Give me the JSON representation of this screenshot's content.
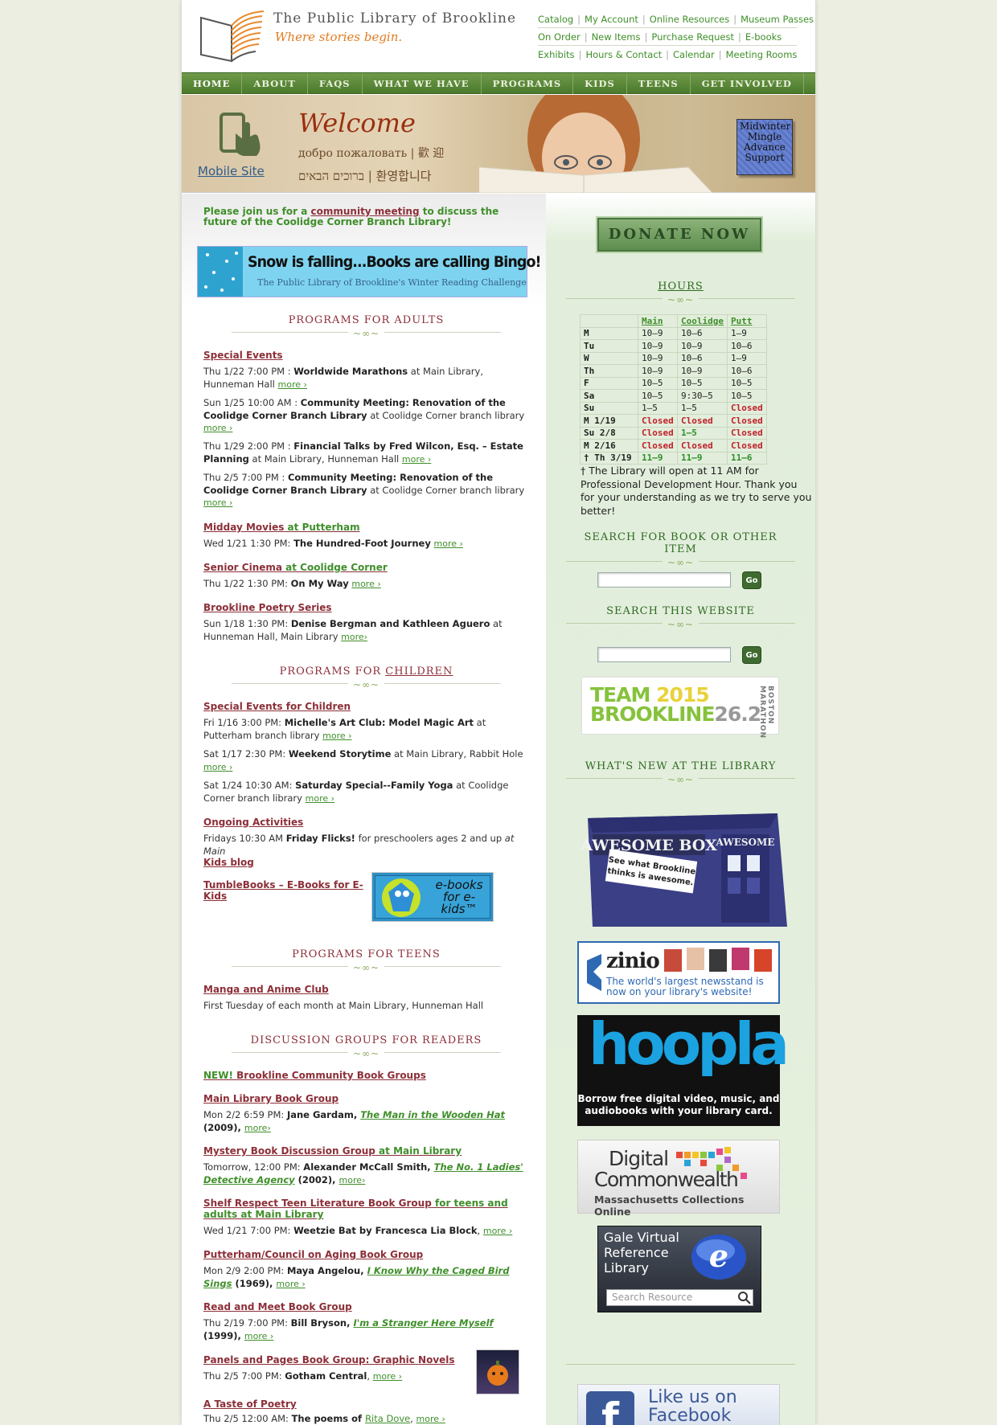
{
  "header": {
    "title": "The Public Library of Brookline",
    "tagline": "Where stories begin.",
    "top_links": [
      [
        "Catalog",
        "My Account",
        "Online Resources",
        "Museum Passes"
      ],
      [
        "On Order",
        "New Items",
        "Purchase Request",
        "E-books"
      ],
      [
        "Exhibits",
        "Hours & Contact",
        "Calendar",
        "Meeting Rooms"
      ]
    ]
  },
  "nav": {
    "items": [
      "HOME",
      "ABOUT",
      "FAQS",
      "WHAT WE HAVE",
      "PROGRAMS",
      "KIDS",
      "TEENS",
      "GET INVOLVED"
    ]
  },
  "banner": {
    "mobile_link": "Mobile Site",
    "welcome": "Welcome",
    "welcome_line1": "добро пожаловать | 歡 迎",
    "welcome_line2": "ברוכים הבאים | 환영합니다",
    "midwinter": [
      "Midwinter",
      "Mingle",
      "Advance",
      "Support"
    ]
  },
  "left": {
    "notice_pre": "Please join us for a ",
    "notice_link": "community meeting",
    "notice_post": " to discuss the future of the Coolidge Corner Branch Library!",
    "snow_title": "Snow is falling...Books are calling Bingo!",
    "snow_sub": "The Public Library of Brookline's Winter Reading Challenge",
    "adults_heading": "PROGRAMS FOR ADULTS",
    "children_heading_pre": "PROGRAMS FOR ",
    "children_heading_link": "CHILDREN",
    "teens_heading": "PROGRAMS FOR TEENS",
    "discussion_heading": "DISCUSSION GROUPS FOR READERS",
    "more": "more ›",
    "special_events": "Special Events",
    "ev1": {
      "when": "Thu 1/22 7:00 PM : ",
      "what": "Worldwide Marathons",
      "where": " at Main Library, Hunneman Hall "
    },
    "ev2": {
      "when": "Sun 1/25 10:00 AM : ",
      "what": "Community Meeting: Renovation of the Coolidge Corner Branch Library",
      "where": " at Coolidge Corner branch library "
    },
    "ev3": {
      "when": "Thu 1/29 2:00 PM : ",
      "what": "Financial Talks by Fred Wilcon, Esq. – Estate Planning",
      "where": " at Main Library, Hunneman Hall "
    },
    "ev4": {
      "when": "Thu 2/5 7:00 PM : ",
      "what": "Community Meeting: Renovation of the Coolidge Corner Branch Library",
      "where": " at Coolidge Corner branch library "
    },
    "midday_title": "Midday Movies",
    "midday_at": " at Putterham",
    "midday": {
      "when": "Wed 1/21 1:30 PM: ",
      "what": "The Hundred-Foot Journey",
      "more": "more ›"
    },
    "senior_title": "Senior Cinema",
    "senior_at": " at Coolidge Corner",
    "senior": {
      "when": "Thu 1/22 1:30 PM: ",
      "what": "On My Way",
      "more": "more ›"
    },
    "poetry_title": "Brookline Poetry Series",
    "poetry": {
      "when": "Sun 1/18 1:30 PM: ",
      "what": "Denise Bergman and Kathleen Aguero",
      "where": " at Hunneman Hall, Main Library ",
      "more": "more›"
    },
    "kids_special_title": "Special Events for Children",
    "kev1": {
      "when": "Fri 1/16 3:00 PM: ",
      "what": "Michelle's Art Club: Model Magic Art",
      "where": " at Putterham branch library "
    },
    "kev2": {
      "when": "Sat 1/17 2:30 PM: ",
      "what": "Weekend Storytime",
      "where": " at Main Library, Rabbit Hole "
    },
    "kev3": {
      "when": "Sat 1/24 10:30 AM: ",
      "what": "Saturday Special--Family Yoga",
      "where": " at Coolidge Corner branch library "
    },
    "ongoing_title": "Ongoing Activities",
    "ongoing": {
      "when": "Fridays 10:30 AM ",
      "what": "Friday Flicks!",
      "where": " for preschoolers ages 2 and up ",
      "at": "at Main"
    },
    "kids_blog": "Kids blog",
    "tumble": "TumbleBooks – E-Books for E-Kids",
    "ebooks_img": "e-books for e-kids™",
    "manga_title": "Manga and Anime Club",
    "manga": "First Tuesday of each month at Main Library, Hunneman Hall",
    "new_label": "NEW! ",
    "community_groups": "Brookline Community Book Groups",
    "mlbg_title": "Main Library Book Group",
    "mlbg": {
      "when": "Mon 2/2 6:59 PM: ",
      "who": "Jane Gardam, ",
      "book": "The Man in the Wooden Hat",
      "year": " (2009), ",
      "more": "more›"
    },
    "mystery_title": "Mystery Book Discussion Group",
    "mystery_at": " at Main Library",
    "mystery": {
      "when": "Tomorrow, 12:00 PM: ",
      "who": "Alexander McCall Smith, ",
      "book": "The No. 1 Ladies' Detective Agency",
      "year": " (2002), ",
      "more": "more›"
    },
    "shelf_title": "Shelf Respect Teen Literature Book Group",
    "shelf_at": " for teens and adults at Main Library",
    "shelf": {
      "when": "Wed 1/21 7:00 PM: ",
      "what": "Weetzie Bat by Francesca Lia Block",
      "more": "more ›"
    },
    "putt_title": "Putterham/Council on Aging Book Group",
    "putt": {
      "when": "Mon 2/9 2:00 PM: ",
      "who": "Maya Angelou, ",
      "book": "I Know Why the Caged Bird Sings",
      "year": " (1969), ",
      "more": "more ›"
    },
    "readmeet_title": "Read and Meet Book Group",
    "readmeet": {
      "when": "Thu 2/19 7:00 PM: ",
      "who": "Bill Bryson, ",
      "book": "I'm a Stranger Here Myself",
      "year": " (1999), ",
      "more": "more ›"
    },
    "panels_title": "Panels and Pages Book Group: Graphic Novels",
    "panels": {
      "when": "Thu 2/5 7:00 PM: ",
      "what": "Gotham Central",
      "more": "more ›"
    },
    "taste_title": "A Taste of Poetry",
    "taste": {
      "when": "Thu 2/5 12:00 AM: ",
      "what": "The poems of ",
      "who": "Rita Dove",
      "more": "more ›"
    }
  },
  "right": {
    "donate": "DONATE NOW",
    "hours_heading": "HOURS",
    "hours_cols": [
      "Main",
      "Coolidge",
      "Putt"
    ],
    "hours_rows": [
      [
        "M",
        "10–9",
        "10–6",
        "1–9"
      ],
      [
        "Tu",
        "10–9",
        "10–9",
        "10–6"
      ],
      [
        "W",
        "10–9",
        "10–6",
        "1–9"
      ],
      [
        "Th",
        "10–9",
        "10–9",
        "10–6"
      ],
      [
        "F",
        "10–5",
        "10–5",
        "10–5"
      ],
      [
        "Sa",
        "10–5",
        "9:30–5",
        "10–5"
      ],
      [
        "Su",
        "1–5",
        "1–5",
        "Closed"
      ],
      [
        "M 1/19",
        "Closed",
        "Closed",
        "Closed"
      ],
      [
        "Su 2/8",
        "Closed",
        "1–5",
        "Closed"
      ],
      [
        "M 2/16",
        "Closed",
        "Closed",
        "Closed"
      ],
      [
        "† Th 3/19",
        "11–9",
        "11–9",
        "11–6"
      ]
    ],
    "hours_note": "† The Library will open at 11 AM for Professional Development Hour. Thank you for your understanding as we try to serve you better!",
    "search_book_heading": "SEARCH FOR BOOK OR OTHER ITEM",
    "search_site_heading": "SEARCH THIS WEBSITE",
    "go": "Go",
    "team_l1_a": "TEAM ",
    "team_l1_b": "2015",
    "team_l2_a": "BROOKLINE",
    "team_l2_b": "26.2",
    "team_side": "BOSTON MARATHON",
    "whats_new_heading": "WHAT'S NEW AT THE LIBRARY",
    "awesome_title": "AWESOME BOX",
    "awesome_sign": "See what Brookline thinks is awesome.",
    "zinio_logo": "zinio",
    "zinio_text": "The world's largest newsstand is now on your library's website!",
    "hoopla_logo": "hoopla",
    "hoopla_text": "Borrow free digital video, music, and audiobooks with your library card.",
    "dc_l1": "Digital",
    "dc_l2": "Commonwealth",
    "dc_l3": "Massachusetts Collections Online",
    "gale_text": "Gale Virtual Reference Library",
    "gale_placeholder": "Search Resource",
    "fb_text": "Like us on Facebook"
  },
  "colors": {
    "accent_green": "#3f8f2a",
    "link_red": "#8c2f38",
    "nav_green": "#5a8838",
    "hours_closed": "#c0202a"
  }
}
